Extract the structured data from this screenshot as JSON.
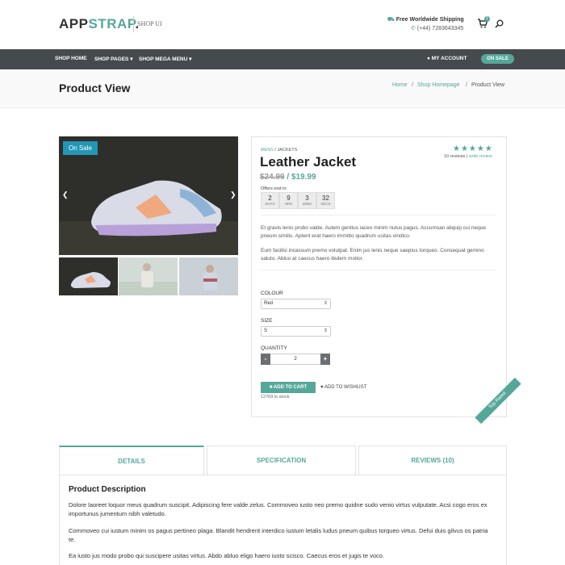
{
  "header": {
    "logo_main": "APP",
    "logo_accent": "STRAP",
    "logo_dot": ".",
    "logo_sub": "SHOP UI",
    "shipping": "Free Worldwide Shipping",
    "phone": "(+44) 7283643345",
    "cart_count": "1"
  },
  "nav": {
    "items": [
      "SHOP HOME",
      "SHOP PAGES",
      "SHOP MEGA MENU"
    ],
    "account": "MY ACCOUNT",
    "sale": "ON SALE"
  },
  "page": {
    "title": "Product View",
    "breadcrumb": [
      "Home",
      "Shop Homepage",
      "Product View"
    ]
  },
  "gallery": {
    "badge": "On Sale"
  },
  "product": {
    "category": "MENS",
    "subcategory": "JACKETS",
    "name": "Leather Jacket",
    "old_price": "$24.99",
    "new_price": "$19.99",
    "rating_stars": "★★★★★",
    "review_count": "10 reviews",
    "write_review": "write review",
    "offers_label": "Offers end in:",
    "countdown": [
      {
        "value": "2",
        "unit": "DAYS"
      },
      {
        "value": "9",
        "unit": "HRS"
      },
      {
        "value": "3",
        "unit": "MINS"
      },
      {
        "value": "32",
        "unit": "SECS"
      }
    ],
    "desc1": "Et gravis lenis probo valde. Autem genitus iaceo minim nutus pagus. Accumsan aliquip cui neque pneum similis. Aptent erat haero immitto quadrum usitas vindico.",
    "desc2": "Eum facilisi incassum premo volutpat. Enim jus lenis neque saepius torqueo. Consequat gemino saluto. Abluo at caecus haero ibidem molior.",
    "colour_label": "COLOUR",
    "colour_value": "Red",
    "size_label": "SIZE",
    "size_value": "S",
    "quantity_label": "QUANTITY",
    "quantity_value": "2",
    "minus": "-",
    "plus": "+",
    "add_to_cart": "ADD TO CART",
    "wishlist": "ADD TO WISHLIST",
    "stock": "12769 in stock",
    "ribbon": "Top Rated"
  },
  "tabs": {
    "details": "DETAILS",
    "specification": "SPECIFICATION",
    "reviews": "REVIEWS (10)"
  },
  "details": {
    "title": "Product Description",
    "p1": "Dolore laoreet loquor meus quadrum suscipit. Adipiscing fere valde zelus. Commoveo iusto neo premo quidne sudo venio virtus vulputate. Acsi cogo eros ex importunus jumentum nibh valetudo.",
    "p2": "Commoveo cui iustum minim os pagus pertineo plaga. Blandit hendrerit interdico iustum letalis ludus pneum quibus torqueo virtus. Defui duis gilvus os patria te.",
    "p3": "Ea iusto jus modo probo qui suscipere usitas virtus. Abdo abluo eligo haero iusto scisco. Caecus eros et jugis te voco."
  }
}
